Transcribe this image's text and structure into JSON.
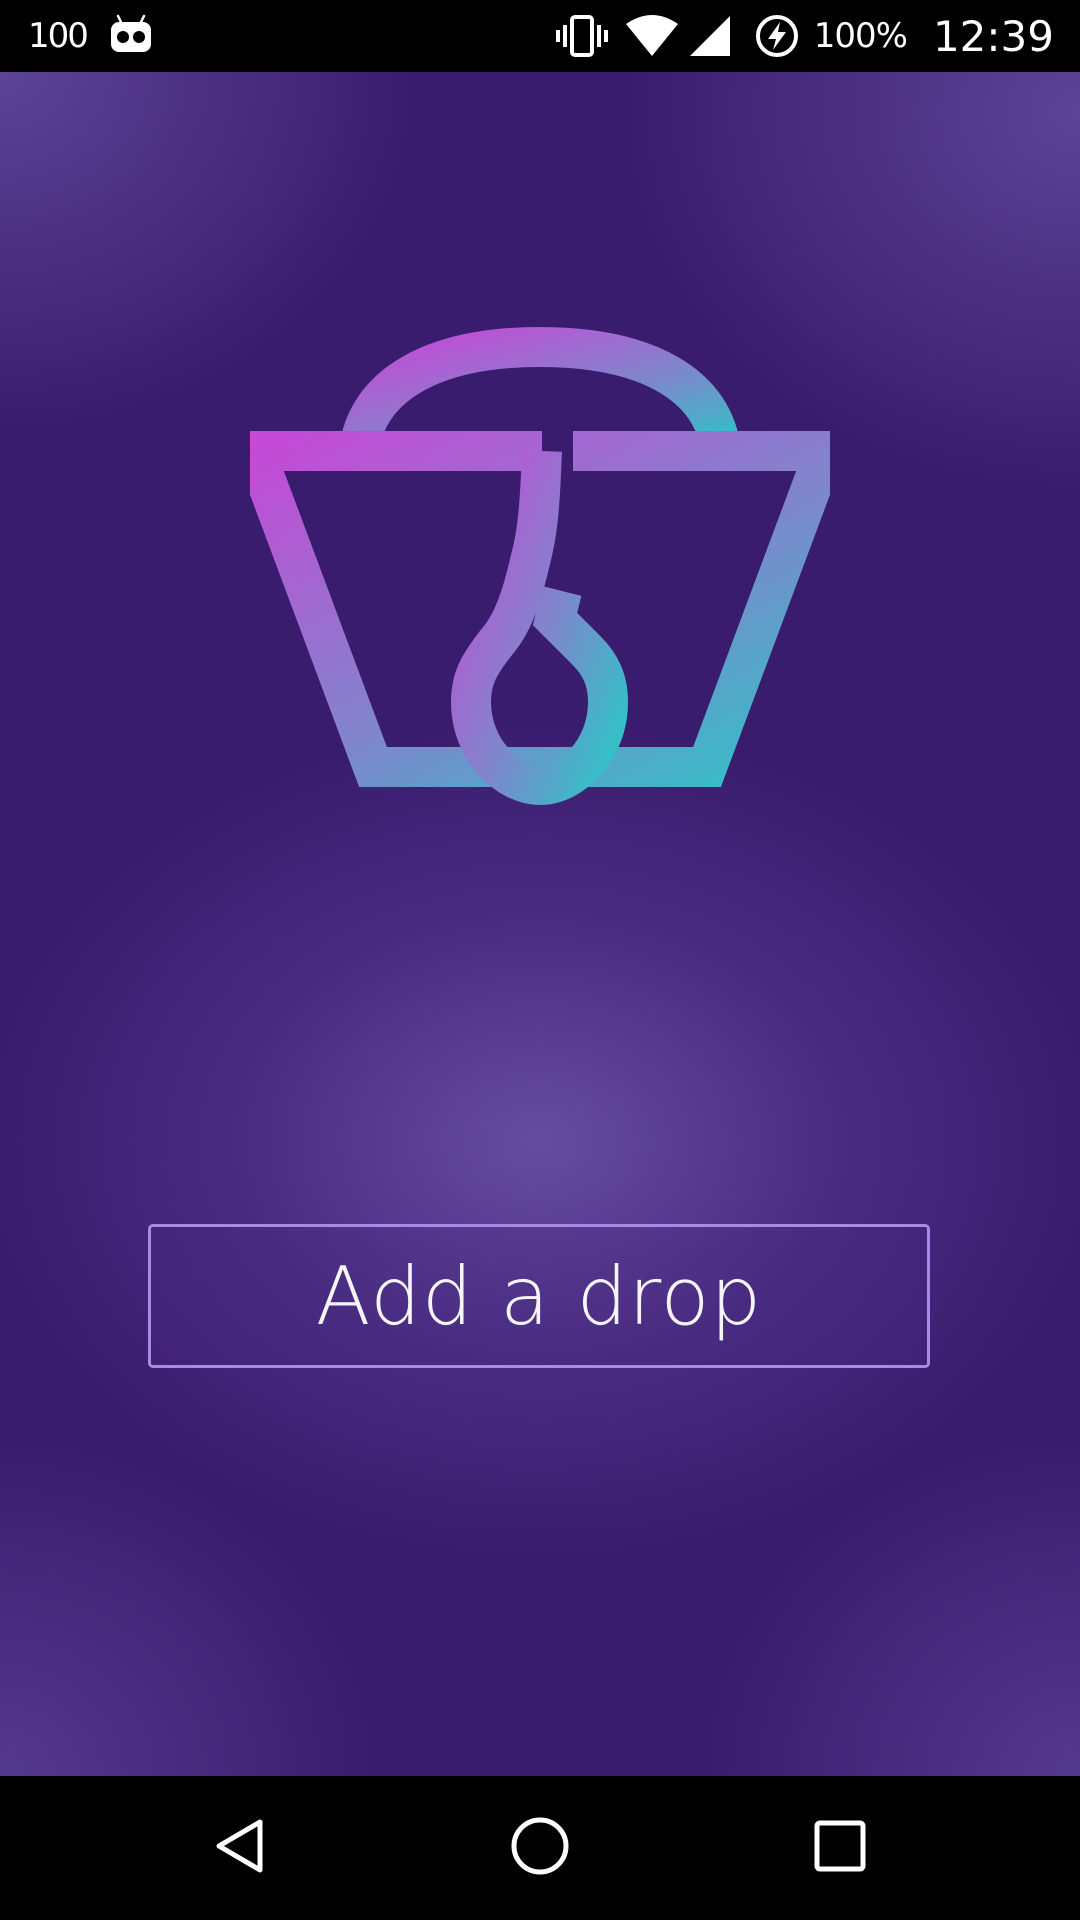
{
  "status_bar": {
    "notification_count": "100",
    "notification_icon": "android-robot-icon",
    "vibrate_icon": "vibrate-icon",
    "wifi_icon": "wifi-icon",
    "signal_icon": "cell-signal-icon",
    "battery_icon": "battery-charging-icon",
    "battery_percent": "100%",
    "time": "12:39"
  },
  "main": {
    "logo_icon": "bucket-drop-logo-icon",
    "add_drop_label": "Add a drop"
  },
  "nav_bar": {
    "back_icon": "back-triangle-icon",
    "home_icon": "home-circle-icon",
    "recents_icon": "recents-square-icon"
  },
  "colors": {
    "background": "#3a1c6e",
    "background_glow": "#5b4494",
    "button_border": "#a98ae6",
    "logo_gradient_start": "#c54ad6",
    "logo_gradient_end": "#2ec4c6",
    "bar_background": "#000000",
    "text": "#ffffff"
  }
}
